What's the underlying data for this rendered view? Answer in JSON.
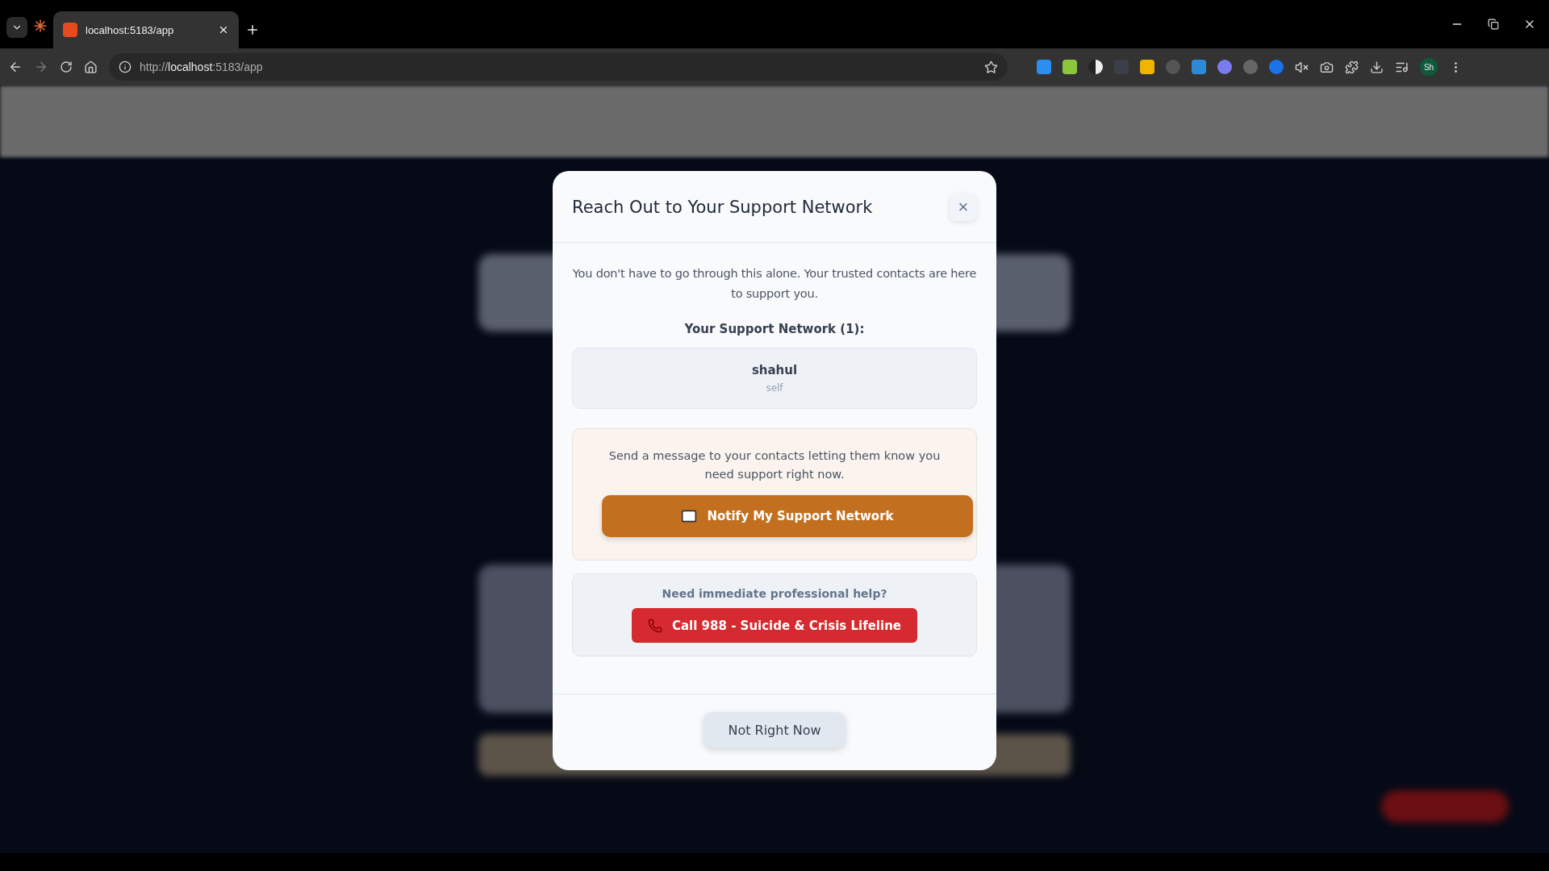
{
  "browser": {
    "tab": {
      "title": "localhost:5183/app",
      "selected": true
    },
    "url_scheme": "http://",
    "url_host": "localhost",
    "url_rest": ":5183/app",
    "profile": "Sh"
  },
  "dialog": {
    "title": "Reach Out to Your Support Network",
    "close": "×",
    "intro": "You don't have to go through this alone. Your trusted contacts are here to support you.",
    "network_heading": "Your Support Network (1):",
    "contacts": [
      {
        "name": "shahul",
        "relation": "self"
      }
    ],
    "notify": {
      "text": "Send a message to your contacts letting them know you need support right now.",
      "button": "Notify My Support Network"
    },
    "help": {
      "text": "Need immediate professional help?",
      "button": "Call 988 - Suicide & Crisis Lifeline"
    },
    "dismiss": "Not Right Now"
  }
}
